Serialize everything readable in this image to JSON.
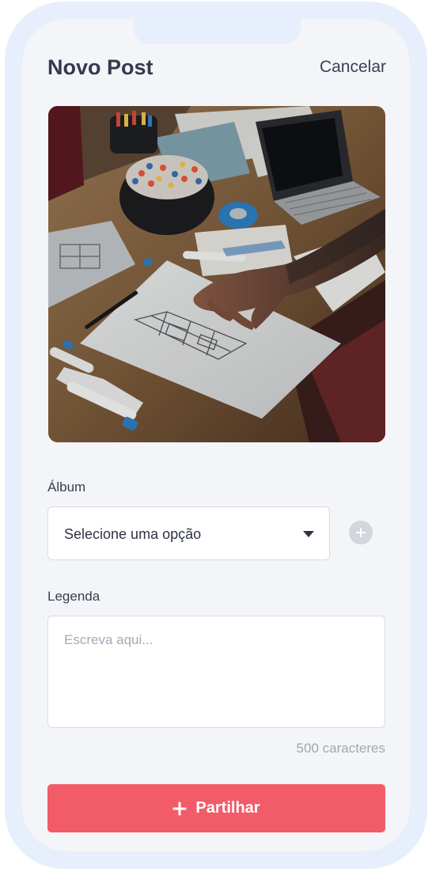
{
  "header": {
    "title": "Novo Post",
    "cancel_label": "Cancelar"
  },
  "album": {
    "label": "Álbum",
    "selected_value": "Selecione uma opção",
    "add_icon": "plus-circle-icon"
  },
  "caption": {
    "label": "Legenda",
    "placeholder": "Escreva aqui...",
    "value": "",
    "char_limit_text": "500 caracteres"
  },
  "share_button": {
    "label": "Partilhar",
    "icon": "plus-icon",
    "color": "#f25c68"
  },
  "colors": {
    "frame": "#e6effb",
    "screen_background": "#f4f5f8",
    "title_text": "#343a4e"
  }
}
